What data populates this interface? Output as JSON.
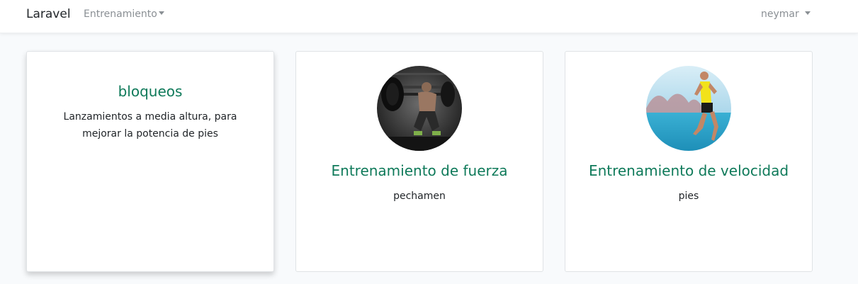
{
  "navbar": {
    "brand": "Laravel",
    "menu": "Entrenamiento",
    "user": "neymar"
  },
  "cards": [
    {
      "title": "bloqueos",
      "description": "Lanzamientos a media altura, para mejorar la potencia de pies"
    },
    {
      "title": "Entrenamiento de fuerza",
      "description": "pechamen",
      "image": "weightlifter-squat-photo"
    },
    {
      "title": "Entrenamiento de velocidad",
      "description": "pies",
      "image": "runner-by-sea-photo"
    }
  ],
  "colors": {
    "title": "#0f7a5a",
    "background": "#f8fafc"
  }
}
